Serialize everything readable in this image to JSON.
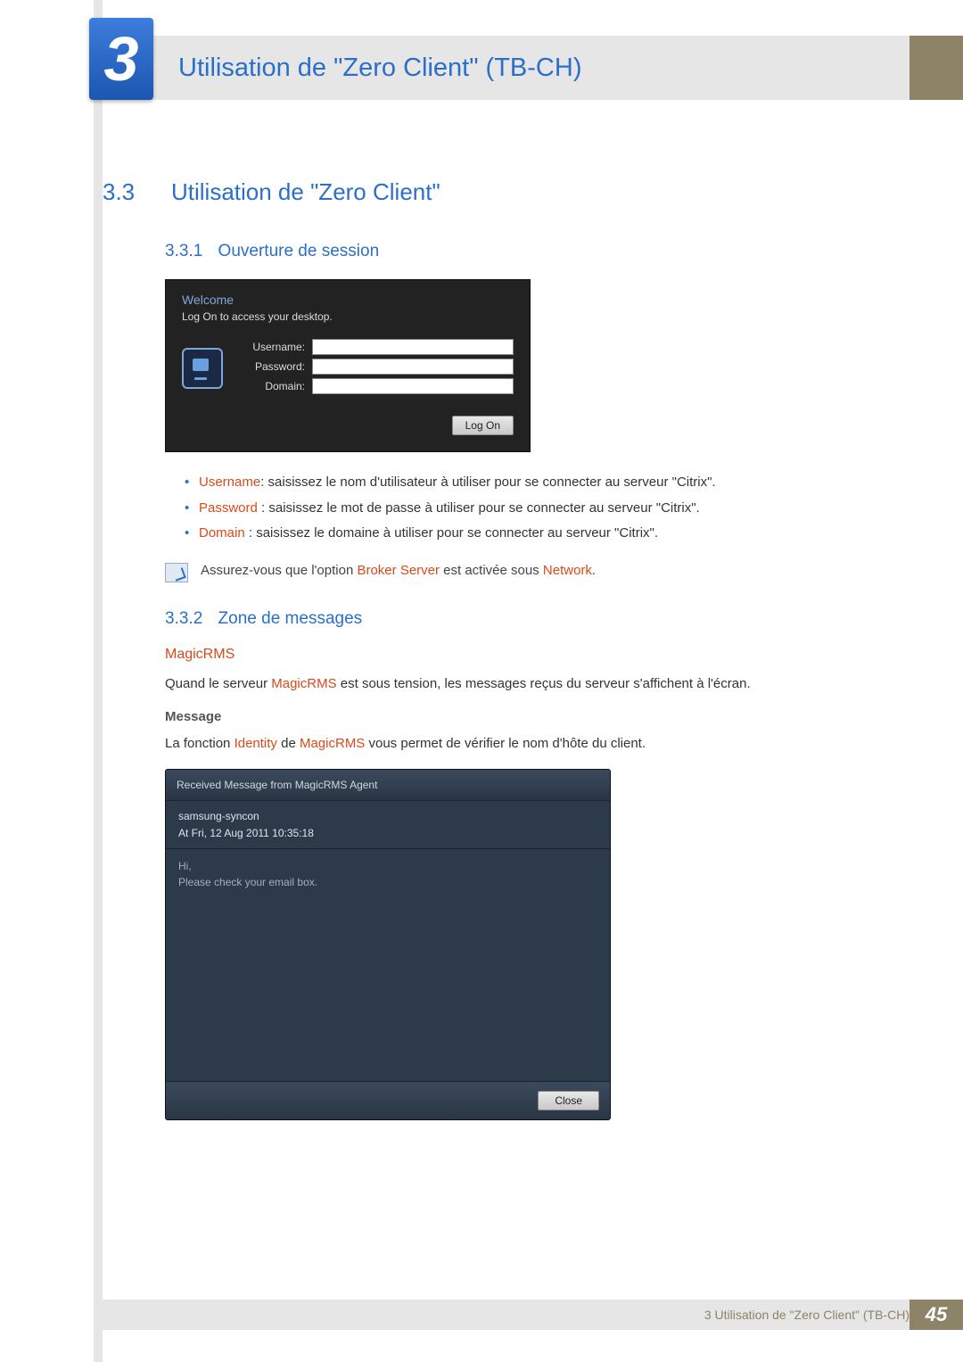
{
  "chapter": {
    "number": "3",
    "title": "Utilisation de \"Zero Client\" (TB-CH)"
  },
  "section": {
    "number": "3.3",
    "title": "Utilisation de \"Zero Client\""
  },
  "sub1": {
    "number": "3.3.1",
    "title": "Ouverture de session",
    "login": {
      "welcome": "Welcome",
      "prompt": "Log On to access your desktop.",
      "labels": {
        "username": "Username:",
        "password": "Password:",
        "domain": "Domain:"
      },
      "button": "Log On"
    },
    "bullets": {
      "username_term": "Username",
      "username_text": ": saisissez le nom d'utilisateur à utiliser pour se connecter au serveur \"Citrix\".",
      "password_term": "Password",
      "password_text": " : saisissez le mot de passe à utiliser pour se connecter au serveur \"Citrix\".",
      "domain_term": "Domain",
      "domain_text": " : saisissez le domaine à utiliser pour se connecter au serveur \"Citrix\"."
    },
    "note": {
      "pre": "Assurez-vous que l'option ",
      "term1": "Broker Server",
      "mid": " est activée sous ",
      "term2": "Network",
      "post": "."
    }
  },
  "sub2": {
    "number": "3.3.2",
    "title": "Zone de messages",
    "h4": "MagicRMS",
    "p1_pre": "Quand le serveur ",
    "p1_term": "MagicRMS",
    "p1_post": " est sous tension, les messages reçus du serveur s'affichent à l'écran.",
    "h5": "Message",
    "p2_pre": "La fonction ",
    "p2_term1": "Identity",
    "p2_mid": " de ",
    "p2_term2": "MagicRMS",
    "p2_post": " vous permet de vérifier le nom d'hôte du client.",
    "dialog": {
      "title": "Received Message from MagicRMS Agent",
      "host": "samsung-syncon",
      "timestamp": "At Fri, 12 Aug 2011 10:35:18",
      "line1": "Hi,",
      "line2": "Please check your email box.",
      "close": "Close"
    }
  },
  "footer": {
    "text": "3 Utilisation de \"Zero Client\" (TB-CH)",
    "page": "45"
  }
}
